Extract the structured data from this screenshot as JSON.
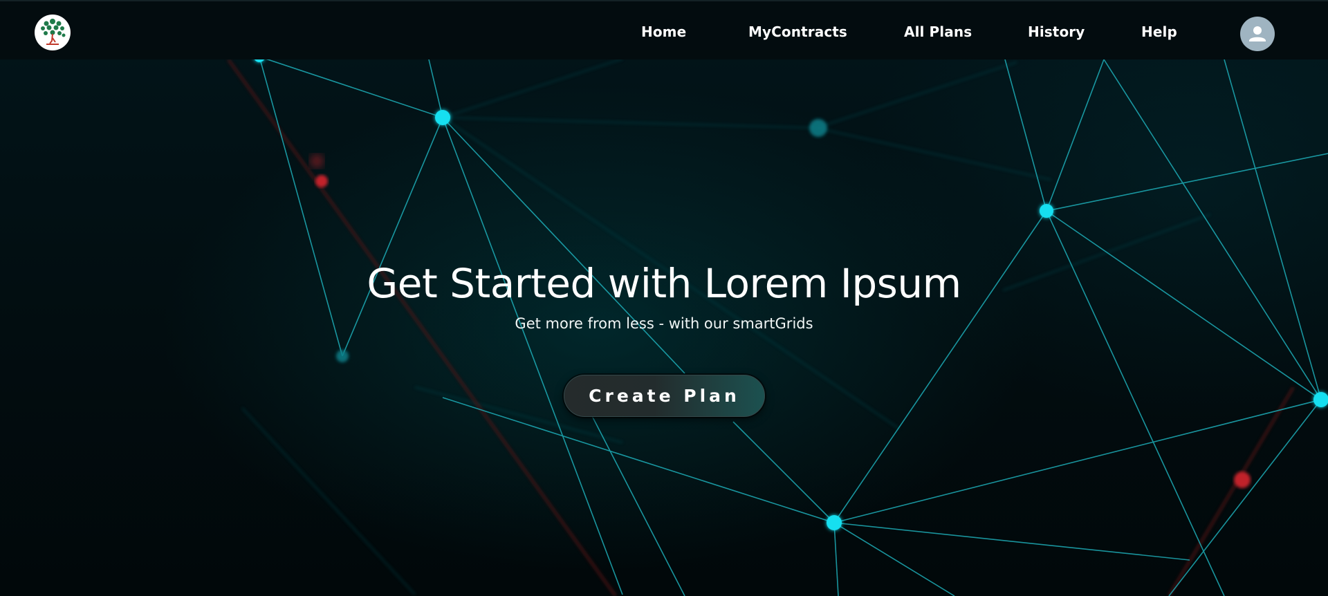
{
  "brand": {
    "logo_icon": "tree-logo-icon",
    "logo_color": "#1f7a4a"
  },
  "nav": {
    "links": [
      {
        "label": "Home"
      },
      {
        "label": "MyContracts"
      },
      {
        "label": "All Plans"
      },
      {
        "label": "History"
      },
      {
        "label": "Help"
      }
    ],
    "profile_icon": "user-icon"
  },
  "hero": {
    "title": "Get Started with Lorem Ipsum",
    "subtitle": "Get more from less - with our smartGrids",
    "cta_label": "Create Plan"
  },
  "theme": {
    "background": "#020b0d",
    "accent": "#00e5f0",
    "alert_dot": "#d42a2f",
    "avatar_bg": "#9fb4c1"
  }
}
